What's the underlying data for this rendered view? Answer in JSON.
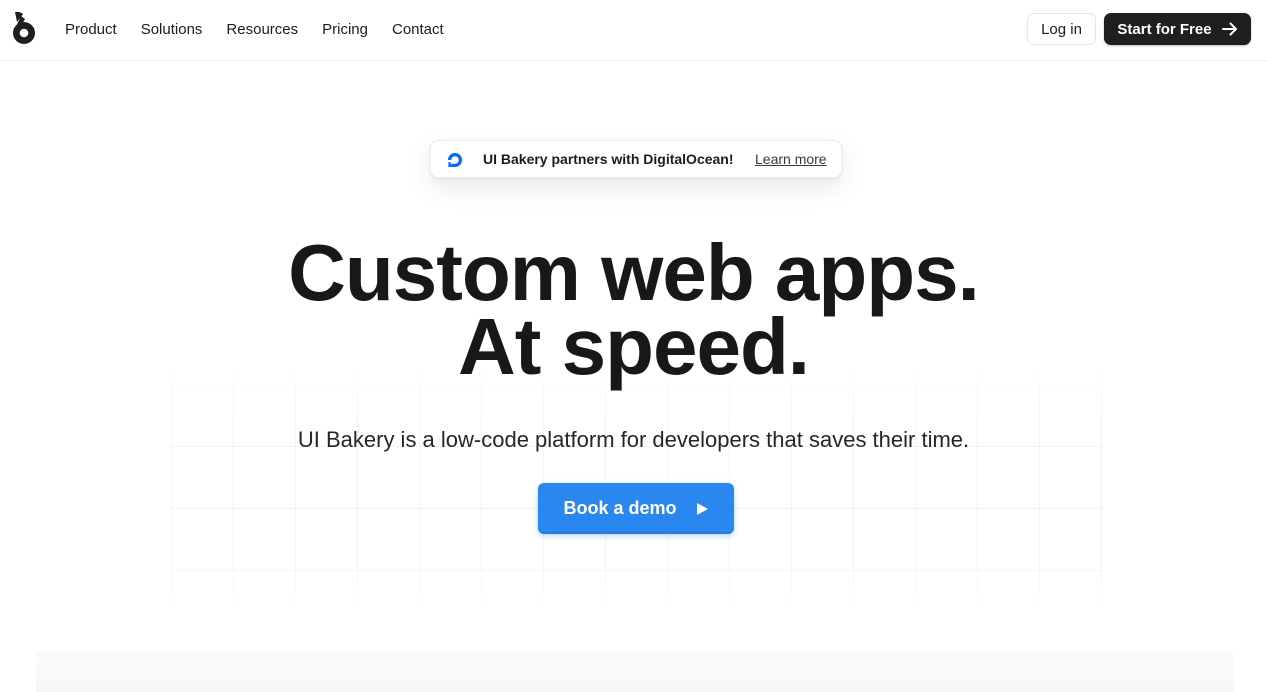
{
  "nav": {
    "items": [
      {
        "label": "Product"
      },
      {
        "label": "Solutions"
      },
      {
        "label": "Resources"
      },
      {
        "label": "Pricing"
      },
      {
        "label": "Contact"
      }
    ],
    "login_label": "Log in",
    "start_label": "Start for Free"
  },
  "announcement": {
    "text": "UI Bakery partners with DigitalOcean!",
    "link_label": "Learn more"
  },
  "hero": {
    "title_line1": "Custom web apps.",
    "title_line2": "At speed.",
    "subtitle": "UI Bakery is a low-code platform for developers that saves their time.",
    "cta_label": "Book a demo"
  },
  "colors": {
    "brand_dark": "#1f1f22",
    "cta_blue": "#2b87f0",
    "digitalocean_blue": "#0069ff"
  },
  "icons": {
    "logo": "ui-bakery-logo-icon",
    "start_arrow": "arrow-right-icon",
    "cta_play": "play-icon",
    "announcement": "digitalocean-logo-icon"
  }
}
